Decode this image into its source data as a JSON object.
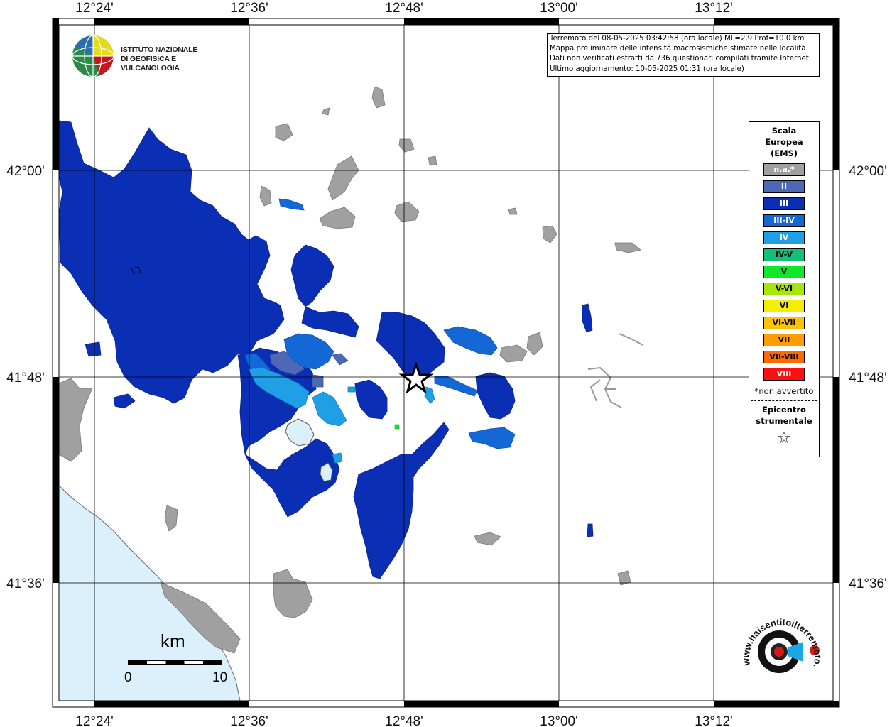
{
  "info_box": {
    "line1": "Terremoto del 08-05-2025 03:42:58 (ora locale) ML=2.9 Prof=10.0 km",
    "line2": "Mappa preliminare delle intensità macrosismiche stimate nelle località",
    "line3": "Dati non verificati estratti da 736 questionari compilati tramite Internet.",
    "line4": "Ultimo aggiornamento: 10-05-2025 01:31 (ora locale)"
  },
  "logo": {
    "line1": "ISTITUTO NAZIONALE",
    "line2": "DI GEOFISICA E VULCANOLOGIA"
  },
  "axes": {
    "top": [
      "12°24'",
      "12°36'",
      "12°48'",
      "13°00'",
      "13°12'"
    ],
    "bottom": [
      "12°24'",
      "12°36'",
      "12°48'",
      "13°00'",
      "13°12'"
    ],
    "left": [
      "42°00'",
      "41°48'",
      "41°36'"
    ],
    "right": [
      "42°00'",
      "41°48'",
      "41°36'"
    ]
  },
  "legend": {
    "title_line1": "Scala",
    "title_line2": "Europea",
    "title_line3": "(EMS)",
    "items": [
      {
        "label": "n.a.*",
        "color": "#a0a0a0"
      },
      {
        "label": "II",
        "color": "#4f68b5"
      },
      {
        "label": "III",
        "color": "#0a2fb5"
      },
      {
        "label": "III-IV",
        "color": "#1468d6"
      },
      {
        "label": "IV",
        "color": "#1e9fe6"
      },
      {
        "label": "IV-V",
        "color": "#12c07a",
        "dark": true
      },
      {
        "label": "V",
        "color": "#10e62a",
        "dark": true
      },
      {
        "label": "V-VI",
        "color": "#a8e60a",
        "dark": true
      },
      {
        "label": "VI",
        "color": "#f2ef00",
        "dark": true
      },
      {
        "label": "VI-VII",
        "color": "#ffc200",
        "dark": true
      },
      {
        "label": "VII",
        "color": "#ff9c00",
        "dark": true
      },
      {
        "label": "VII-VIII",
        "color": "#ff6a00",
        "dark": true
      },
      {
        "label": "VIII",
        "color": "#ff1010"
      }
    ],
    "note": "*non avvertito",
    "epi_line1": "Epicentro",
    "epi_line2": "strumentale",
    "epi_symbol": "☆"
  },
  "scale_bar": {
    "unit": "km",
    "start": "0",
    "end": "10"
  },
  "brand": {
    "text": "www.haisentitoilterremoto.it"
  },
  "colors": {
    "sea": "#dcf0fc",
    "land": "#ffffff",
    "grid": "#000000",
    "gray_area": "#a0a0a0",
    "level_III": "#0a2fb5",
    "level_III_IV": "#1468d6",
    "level_IV": "#1e9fe6",
    "level_V": "#10e62a",
    "epicenter": "#000000"
  }
}
